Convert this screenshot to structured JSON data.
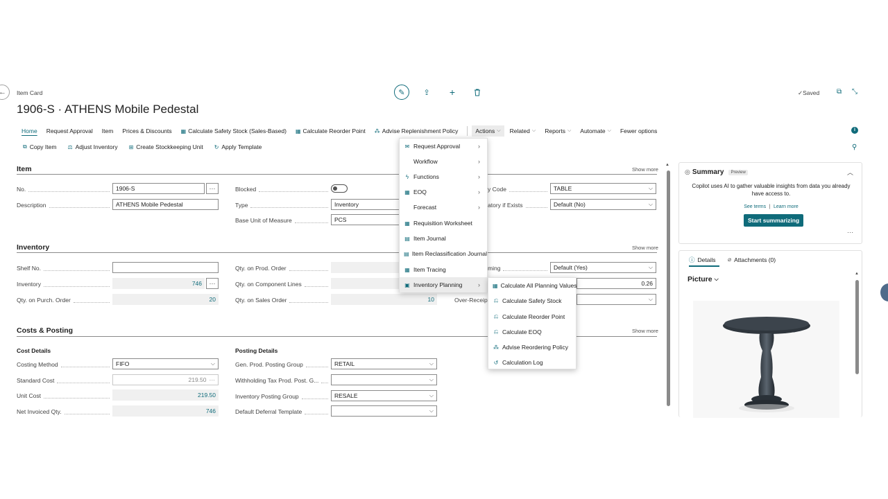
{
  "header": {
    "breadcrumb": "Item Card",
    "title": "1906-S · ATHENS Mobile Pedestal",
    "saved": "Saved"
  },
  "nav": {
    "home": "Home",
    "request_approval": "Request Approval",
    "item": "Item",
    "prices_discounts": "Prices & Discounts",
    "calc_safety_stock": "Calculate Safety Stock (Sales-Based)",
    "calc_reorder_point": "Calculate Reorder Point",
    "advise_replenishment": "Advise Replenishment Policy",
    "actions": "Actions",
    "related": "Related",
    "reports": "Reports",
    "automate": "Automate",
    "fewer_options": "Fewer options"
  },
  "subbar": {
    "copy_item": "Copy Item",
    "adjust_inventory": "Adjust Inventory",
    "create_sku": "Create Stockkeeping Unit",
    "apply_template": "Apply Template"
  },
  "show_more": "Show more",
  "item_section": {
    "title": "Item",
    "no_label": "No.",
    "no_value": "1906-S",
    "description_label": "Description",
    "description_value": "ATHENS Mobile Pedestal",
    "blocked_label": "Blocked",
    "type_label": "Type",
    "type_value": "Inventory",
    "base_uom_label": "Base Unit of Measure",
    "base_uom_value": "PCS",
    "cat_code_label": "y Code",
    "cat_code_value": "TABLE",
    "mandatory_label": "atory if Exists",
    "mandatory_value": "Default (No)"
  },
  "inventory_section": {
    "title": "Inventory",
    "shelf_label": "Shelf No.",
    "shelf_value": "",
    "inventory_label": "Inventory",
    "inventory_value": "746",
    "qty_purch_label": "Qty. on Purch. Order",
    "qty_purch_value": "20",
    "qty_prod_label": "Qty. on Prod. Order",
    "qty_comp_label": "Qty. on Component Lines",
    "qty_sales_label": "Qty. on Sales Order",
    "qty_sales_value": "10",
    "ming_label": "ming",
    "ming_value": "Default (Yes)",
    "r3_value": "0.26",
    "over_receipt_label": "Over-Receipt"
  },
  "costs_section": {
    "title": "Costs & Posting",
    "cost_details": "Cost Details",
    "costing_method_label": "Costing Method",
    "costing_method_value": "FIFO",
    "standard_cost_label": "Standard Cost",
    "standard_cost_value": "219.50",
    "unit_cost_label": "Unit Cost",
    "unit_cost_value": "219.50",
    "net_invoiced_label": "Net Invoiced Qty.",
    "net_invoiced_value": "746",
    "posting_details": "Posting Details",
    "gen_prod_label": "Gen. Prod. Posting Group",
    "gen_prod_value": "RETAIL",
    "withholding_label": "Withholding Tax Prod. Post. G...",
    "withholding_value": "",
    "inv_posting_label": "Inventory Posting Group",
    "inv_posting_value": "RESALE",
    "deferral_label": "Default Deferral Template",
    "deferral_value": ""
  },
  "actions_menu": {
    "items": [
      {
        "label": "Request Approval",
        "icon": "approval-icon",
        "submenu": true
      },
      {
        "label": "Workflow",
        "icon": "",
        "submenu": true
      },
      {
        "label": "Functions",
        "icon": "lightning-icon",
        "submenu": true
      },
      {
        "label": "EOQ",
        "icon": "sheet-icon",
        "submenu": true
      },
      {
        "label": "Forecast",
        "icon": "",
        "submenu": true
      },
      {
        "label": "Requisition Worksheet",
        "icon": "sheet-icon",
        "submenu": false
      },
      {
        "label": "Item Journal",
        "icon": "journal-icon",
        "submenu": false
      },
      {
        "label": "Item Reclassification Journal",
        "icon": "journal-icon",
        "submenu": false
      },
      {
        "label": "Item Tracing",
        "icon": "sheet-icon",
        "submenu": false
      },
      {
        "label": "Inventory Planning",
        "icon": "planning-icon",
        "submenu": true
      }
    ]
  },
  "planning_submenu": {
    "items": [
      {
        "label": "Calculate All Planning Values",
        "icon": "sheet-icon"
      },
      {
        "label": "Calculate Safety Stock",
        "icon": "calc-icon"
      },
      {
        "label": "Calculate Reorder Point",
        "icon": "calc-icon"
      },
      {
        "label": "Calculate EOQ",
        "icon": "calc-icon"
      },
      {
        "label": "Advise Reordering Policy",
        "icon": "advise-icon"
      },
      {
        "label": "Calculation Log",
        "icon": "log-icon"
      }
    ]
  },
  "summary": {
    "title": "Summary",
    "badge": "Preview",
    "text": "Copilot uses AI to gather valuable insights from data you already have access to.",
    "see_terms": "See terms",
    "separator": "|",
    "learn_more": "Learn more",
    "button": "Start summarizing",
    "more": "···"
  },
  "factbox": {
    "tab_details": "Details",
    "tab_attachments": "Attachments (0)",
    "picture_label": "Picture"
  },
  "colors": {
    "accent": "#0f6b7a",
    "menu_highlight": "#ebebeb"
  }
}
